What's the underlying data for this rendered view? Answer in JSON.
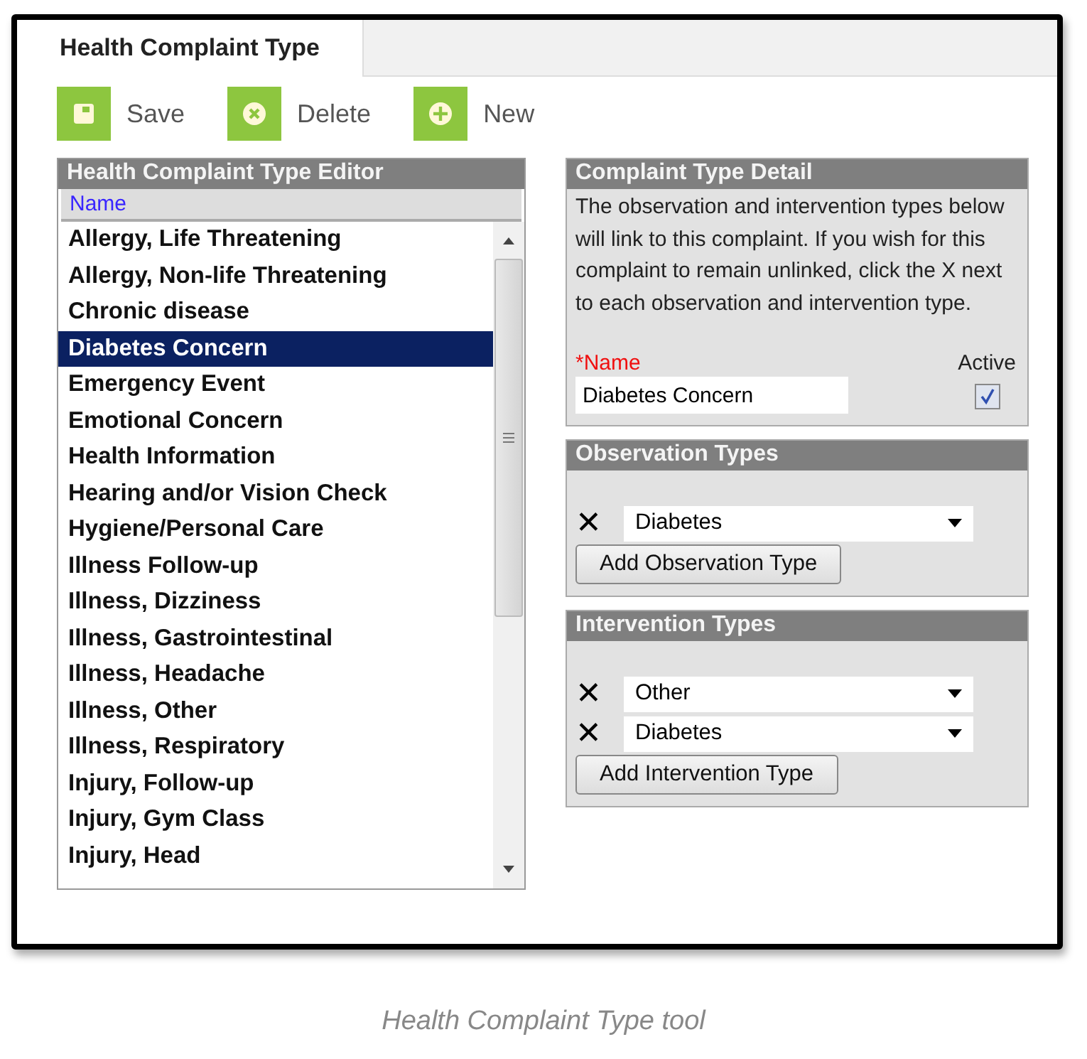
{
  "tab": {
    "label": "Health Complaint Type",
    "selected": true
  },
  "toolbar": [
    {
      "kind": "save",
      "label": "Save"
    },
    {
      "kind": "delete",
      "label": "Delete"
    },
    {
      "kind": "new",
      "label": "New"
    }
  ],
  "editor": {
    "title": "Health Complaint Type Editor",
    "column": "Name",
    "items": [
      {
        "label": "Allergy, Life Threatening",
        "selected": false
      },
      {
        "label": "Allergy, Non-life Threatening",
        "selected": false
      },
      {
        "label": "Chronic disease",
        "selected": false
      },
      {
        "label": "Diabetes Concern",
        "selected": true
      },
      {
        "label": "Emergency Event",
        "selected": false
      },
      {
        "label": "Emotional Concern",
        "selected": false
      },
      {
        "label": "Health Information",
        "selected": false
      },
      {
        "label": "Hearing and/or Vision Check",
        "selected": false
      },
      {
        "label": "Hygiene/Personal Care",
        "selected": false
      },
      {
        "label": "Illness Follow-up",
        "selected": false
      },
      {
        "label": "Illness, Dizziness",
        "selected": false
      },
      {
        "label": "Illness, Gastrointestinal",
        "selected": false
      },
      {
        "label": "Illness, Headache",
        "selected": false
      },
      {
        "label": "Illness, Other",
        "selected": false
      },
      {
        "label": "Illness, Respiratory",
        "selected": false
      },
      {
        "label": "Injury, Follow-up",
        "selected": false
      },
      {
        "label": "Injury, Gym Class",
        "selected": false
      },
      {
        "label": "Injury, Head",
        "selected": false
      }
    ]
  },
  "detail": {
    "title": "Complaint Type Detail",
    "description": "The observation and intervention types below will link to this complaint. If you wish for this complaint to remain unlinked, click the X next to each observation and intervention type.",
    "name_label": "*Name",
    "name_value": "Diabetes Concern",
    "active_label": "Active",
    "active": true
  },
  "observation_types": {
    "title": "Observation Types",
    "items": [
      {
        "remove": "✕",
        "value": "Diabetes"
      }
    ],
    "button": "Add Observation Type"
  },
  "intervention_types": {
    "title": "Intervention Types",
    "items": [
      {
        "remove": "✕",
        "value": "Other"
      },
      {
        "remove": "✕",
        "value": "Diabetes"
      }
    ],
    "button": "Add Intervention Type"
  },
  "caption": "Health Complaint Type tool"
}
